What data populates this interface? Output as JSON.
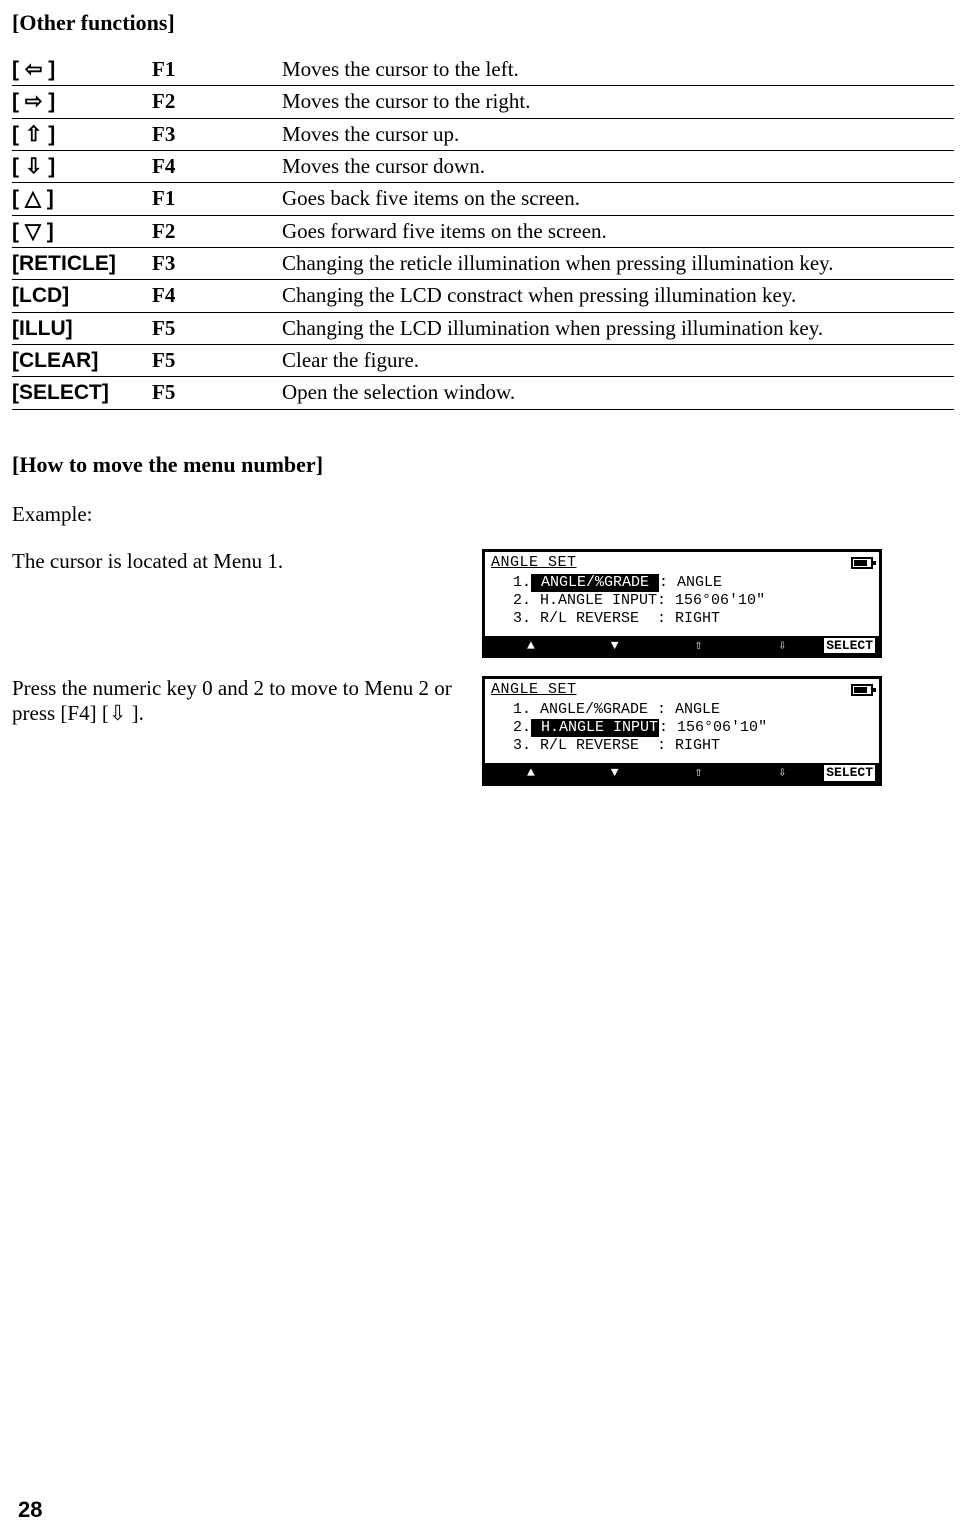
{
  "section1_title": "[Other functions]",
  "funcs": [
    {
      "label": "[ ⇦ ]",
      "key": "F1",
      "desc": "Moves the cursor to the left."
    },
    {
      "label": "[ ⇨ ]",
      "key": "F2",
      "desc": "Moves the cursor to the right."
    },
    {
      "label": "[ ⇧ ]",
      "key": "F3",
      "desc": "Moves the cursor up."
    },
    {
      "label": "[ ⇩ ]",
      "key": "F4",
      "desc": "Moves the cursor down."
    },
    {
      "label": "[ △ ]",
      "key": "F1",
      "desc": "Goes back five items on the screen."
    },
    {
      "label": "[ ▽ ]",
      "key": "F2",
      "desc": "Goes forward five items on the screen."
    },
    {
      "label": "[RETICLE]",
      "key": "F3",
      "desc": "Changing the reticle illumination when pressing illumination key."
    },
    {
      "label": "[LCD]",
      "key": "F4",
      "desc": "Changing the LCD constract when pressing illumination key."
    },
    {
      "label": "[ILLU]",
      "key": "F5",
      "desc": "Changing the LCD illumination when pressing illumination key."
    },
    {
      "label": "[CLEAR]",
      "key": "F5",
      "desc": "Clear the figure."
    },
    {
      "label": "[SELECT]",
      "key": "F5",
      "desc": "Open the selection window."
    }
  ],
  "section2_title": "[How to move the menu number]",
  "example_label": "Example:",
  "step1_text": "The cursor is located at Menu 1.",
  "step2_text": "Press the numeric key 0 and 2 to move to Menu 2 or press [F4] [⇩  ].",
  "lcd": {
    "title": "ANGLE SET",
    "lines": [
      {
        "num": "1.",
        "left": " ANGLE/%GRADE ",
        "right": ": ANGLE"
      },
      {
        "num": "2.",
        "left": " H.ANGLE INPUT",
        "right": ": 156°06'10\""
      },
      {
        "num": "3.",
        "left": " R/L REVERSE  ",
        "right": ": RIGHT"
      }
    ],
    "select_label": "SELECT"
  },
  "screen1_selected": 0,
  "screen2_selected": 1,
  "page_number": "28"
}
